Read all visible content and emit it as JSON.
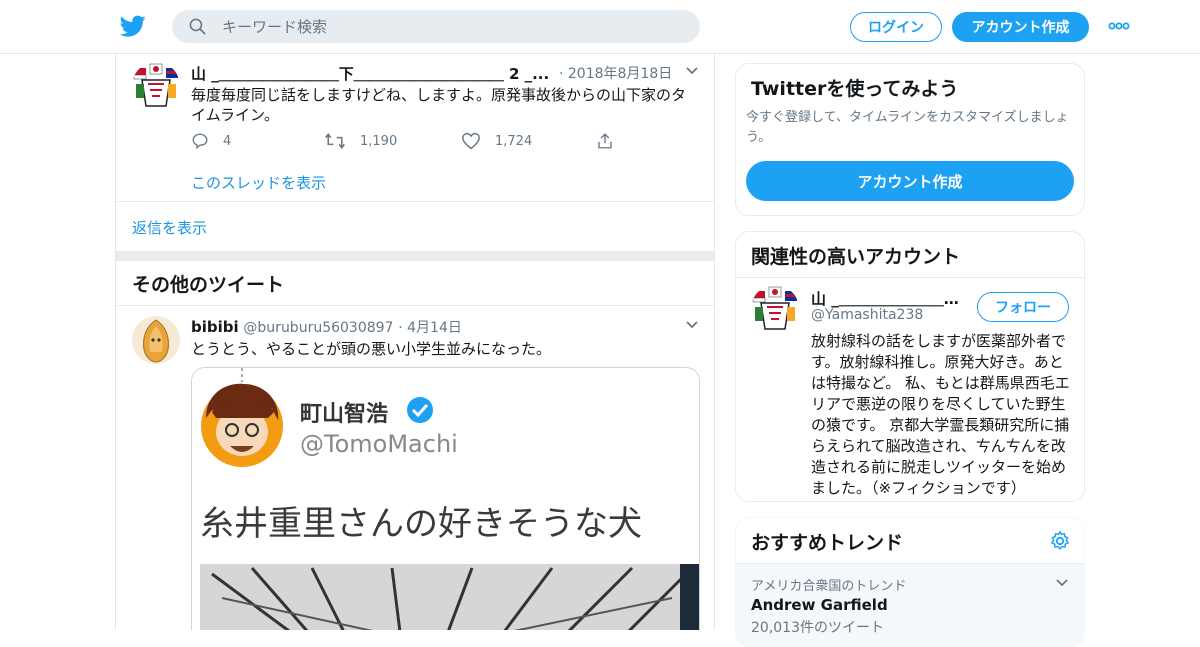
{
  "header": {
    "search_placeholder": "キーワード検索",
    "login_label": "ログイン",
    "signup_label": "アカウント作成"
  },
  "tweet1": {
    "author": "山 _＿＿＿＿＿＿＿＿下＿＿＿＿＿＿＿＿＿＿ 2 _...",
    "date": "· 2018年8月18日",
    "text": "毎度毎度同じ話をしますけどね、しますよ。原発事故後からの山下家のタイムライン。",
    "replies": "4",
    "retweets": "1,190",
    "likes": "1,724",
    "thread_link": "このスレッドを表示"
  },
  "show_replies": "返信を表示",
  "other_tweets_title": "その他のツイート",
  "tweet2": {
    "name": "bibibi",
    "handle": "@buruburu56030897",
    "date": "· 4月14日",
    "text": "とうとう、やることが頭の悪い小学生並みになった。",
    "media": {
      "name": "町山智浩",
      "handle": "@TomoMachi",
      "text": "糸井重里さんの好きそうな犬"
    }
  },
  "sidebar": {
    "signup_card": {
      "title": "Twitterを使ってみよう",
      "subtitle": "今すぐ登録して、タイムラインをカスタマイズしましょう。",
      "button": "アカウント作成"
    },
    "relevant": {
      "title": "関連性の高いアカウント",
      "name": "山 _＿＿＿＿＿＿＿＿...",
      "handle": "@Yamashita238",
      "follow_label": "フォロー",
      "bio": "放射線科の話をしますが医薬部外者です。放射線科推し。原発大好き。あとは特撮など。 私、もとは群馬県西毛エリアで悪逆の限りを尽くしていた野生の猿です。 京都大学霊長類研究所に捕らえられて脳改造され、ㄘんㄘんを改造される前に脱走しツイッターを始めました。（※フィクションです）"
    },
    "trends": {
      "title": "おすすめトレンド",
      "context": "アメリカ合衆国のトレンド",
      "name": "Andrew Garfield",
      "count": "20,013件のツイート"
    }
  },
  "colors": {
    "accent": "#1da1f2",
    "link": "#1b95e0",
    "muted": "#657786"
  }
}
